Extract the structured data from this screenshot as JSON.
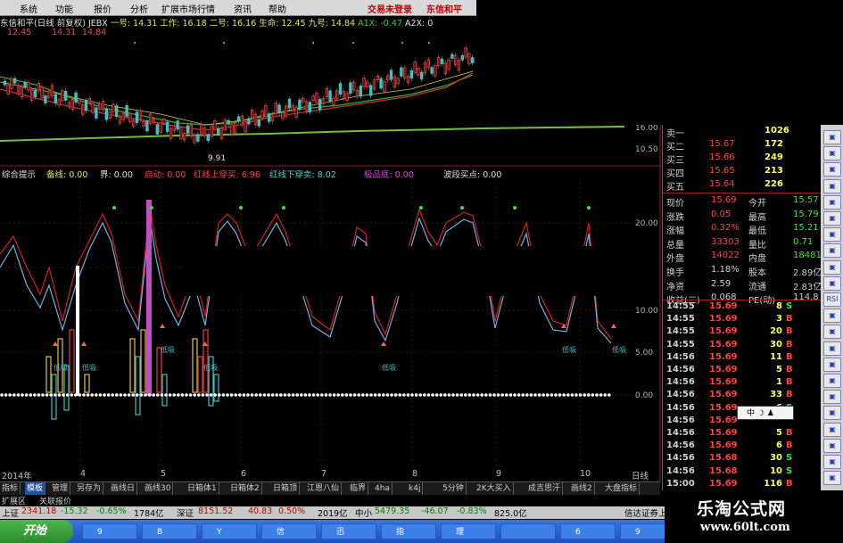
{
  "menu": [
    "系统",
    "功能",
    "报价",
    "分析",
    "扩展市场行情",
    "资讯",
    "帮助"
  ],
  "menu_right": [
    "交易未登录",
    "东信和平"
  ],
  "info1": {
    "stock": "东信和平(日线 前复权) JEBX",
    "ma1": "一号: 14.31",
    "ma2": "工作: 16.18",
    "ma3": "二号: 16.16",
    "ma4": "生命: 12.45",
    "ma5": "九号: 14.84",
    "aix": "A1X: -0.47",
    "a2x": "A2X: 0"
  },
  "info2": [
    "12.45",
    "14.31",
    "14.84"
  ],
  "price_labels": {
    "low": "9.91",
    "p16": "16.00",
    "p1050": "10.50"
  },
  "ind_header": [
    {
      "t": "综合提示",
      "c": "wht"
    },
    {
      "t": "备线: 0.00",
      "c": "yel"
    },
    {
      "t": "界: 0.00",
      "c": "wht"
    },
    {
      "t": "启动: 0.00",
      "c": "red"
    },
    {
      "t": "红线上穿买: 6.96",
      "c": "red"
    },
    {
      "t": "红线下穿卖: 8.02",
      "c": "cyn"
    },
    {
      "t": "极品底: 0.00",
      "c": "mag"
    },
    {
      "t": "波段买点: 0.00",
      "c": "wht"
    }
  ],
  "ind_axis": [
    "20.00",
    "15.00",
    "10.00",
    "5.00",
    "0.00"
  ],
  "xaxis": [
    "2014年",
    "4",
    "5",
    "6",
    "7",
    "8",
    "9",
    "10",
    "日线"
  ],
  "tabs": [
    "指标",
    "模板",
    "管理",
    "另存为",
    "画线日",
    "画线30",
    "日箱体1",
    "日箱体2",
    "日箱顶",
    "江恩八仙",
    "临界",
    "4ha",
    "k4j",
    "5分钟",
    "2K大买入",
    "成吉思汗",
    "画线2",
    "大盘指标"
  ],
  "tabs2": [
    "扩展区",
    "关联报价"
  ],
  "signal_labels": [
    "低吸",
    "低吸",
    "低吸",
    "低吸",
    "低吸",
    "低吸",
    "低吸",
    "低吸"
  ],
  "status": {
    "sh": "上证",
    "sh_v": "2341.18",
    "sh_c": "-15.32",
    "sh_p": "-0.65%",
    "sh_a": "1784亿",
    "sz": "深证",
    "sz_v": "8151.52",
    "sz_c": "40.83",
    "sz_p": "0.50%",
    "sz_a": "2019亿",
    "zx": "中小",
    "zx_v": "5479.35",
    "zx_c": "-46.07",
    "zx_p": "-0.83%",
    "zx_a": "825.0亿",
    "right": "信达证券上"
  },
  "start": "开始",
  "tasks": [
    "9",
    "B",
    "Y",
    "信",
    "迅",
    "指",
    "理",
    "",
    "6",
    "9"
  ],
  "quote": {
    "asks": [
      {
        "l": "卖一",
        "p": "",
        "v": "1026"
      },
      {
        "l": "买二",
        "p": "15.67",
        "v": "172"
      },
      {
        "l": "买三",
        "p": "15.66",
        "v": "249"
      },
      {
        "l": "买四",
        "p": "15.65",
        "v": "213"
      },
      {
        "l": "买五",
        "p": "15.64",
        "v": "226"
      }
    ],
    "stats": [
      {
        "a": "现价",
        "b": "15.69",
        "c": "今开",
        "d": "15.57"
      },
      {
        "a": "涨跌",
        "b": "0.05",
        "c": "最高",
        "d": "15.79"
      },
      {
        "a": "涨幅",
        "b": "0.32%",
        "c": "最低",
        "d": "15.21"
      },
      {
        "a": "总量",
        "b": "33303",
        "c": "量比",
        "d": "0.71"
      },
      {
        "a": "外盘",
        "b": "14022",
        "c": "内盘",
        "d": "18481"
      },
      {
        "a": "换手",
        "b": "1.18%",
        "c": "股本",
        "d": "2.89亿"
      },
      {
        "a": "净资",
        "b": "2.59",
        "c": "流通",
        "d": "2.83亿"
      },
      {
        "a": "收益(二)",
        "b": "0.068",
        "c": "PE(动)",
        "d": "114.8"
      }
    ],
    "ticks": [
      [
        "14:55",
        "15.69",
        "8",
        "S"
      ],
      [
        "14:55",
        "15.69",
        "3",
        "B"
      ],
      [
        "14:55",
        "15.69",
        "20",
        "B"
      ],
      [
        "14:55",
        "15.69",
        "30",
        "B"
      ],
      [
        "14:56",
        "15.69",
        "11",
        "B"
      ],
      [
        "14:56",
        "15.69",
        "5",
        "B"
      ],
      [
        "14:56",
        "15.69",
        "1",
        "B"
      ],
      [
        "14:56",
        "15.69",
        "33",
        "B"
      ],
      [
        "14:56",
        "15.69",
        "6",
        "S"
      ],
      [
        "14:56",
        "15.69",
        "",
        ""
      ],
      [
        "14:56",
        "15.69",
        "5",
        "B"
      ],
      [
        "14:56",
        "15.69",
        "6",
        "B"
      ],
      [
        "14:56",
        "15.68",
        "30",
        "S"
      ],
      [
        "14:56",
        "15.68",
        "10",
        "S"
      ],
      [
        "15:00",
        "15.69",
        "116",
        "B"
      ]
    ]
  },
  "sidebar": [
    "",
    "",
    "",
    "",
    "",
    "",
    "",
    "",
    "",
    "",
    "RSI",
    "",
    "",
    "",
    "",
    "",
    "",
    "",
    "",
    "",
    "",
    ""
  ],
  "popup": "中 ☽ ♟",
  "brand": {
    "title": "乐淘公式网",
    "url": "www.60lt.com"
  }
}
